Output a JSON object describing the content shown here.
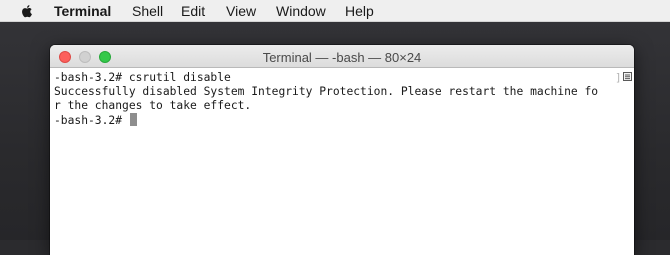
{
  "menubar": {
    "app_name": "Terminal",
    "items": [
      "Shell",
      "Edit",
      "View",
      "Window",
      "Help"
    ]
  },
  "window": {
    "title": "Terminal — -bash — 80×24"
  },
  "terminal": {
    "lines": [
      "-bash-3.2# csrutil disable",
      "Successfully disabled System Integrity Protection. Please restart the machine fo",
      "r the changes to take effect.",
      "-bash-3.2# "
    ]
  },
  "icons": {
    "menubar": "apple-icon",
    "window_controls": [
      "close-icon",
      "minimize-icon",
      "maximize-icon"
    ],
    "scroll": "scroll-marker-icon"
  },
  "colors": {
    "close": "#fc605c",
    "minimize": "#d1d1d1",
    "maximize": "#34c84a",
    "cursor": "#8e8e8e"
  }
}
